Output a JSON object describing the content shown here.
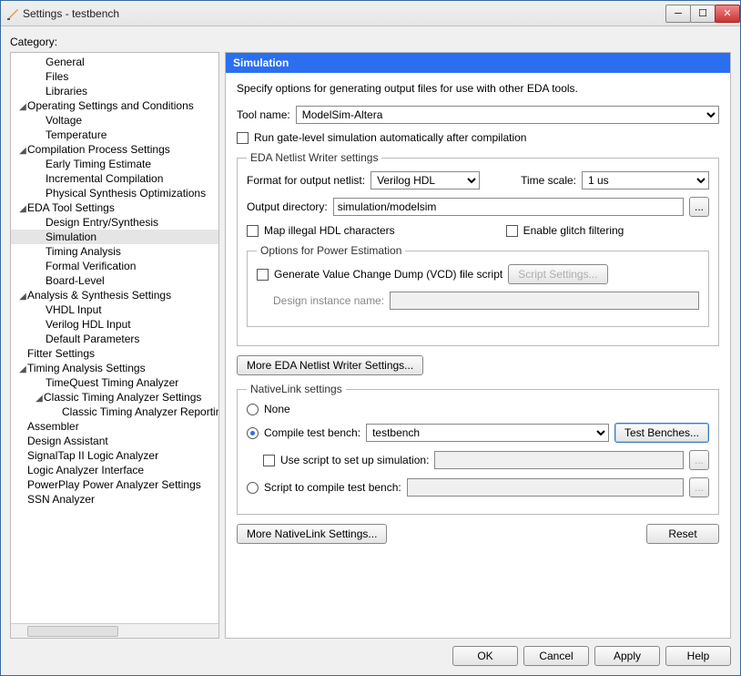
{
  "title": "Settings - testbench",
  "category_label": "Category:",
  "tree": {
    "items": [
      {
        "label": "General",
        "depth": 1
      },
      {
        "label": "Files",
        "depth": 1
      },
      {
        "label": "Libraries",
        "depth": 1
      },
      {
        "label": "Operating Settings and Conditions",
        "depth": 0,
        "expanded": true
      },
      {
        "label": "Voltage",
        "depth": 1
      },
      {
        "label": "Temperature",
        "depth": 1
      },
      {
        "label": "Compilation Process Settings",
        "depth": 0,
        "expanded": true
      },
      {
        "label": "Early Timing Estimate",
        "depth": 1
      },
      {
        "label": "Incremental Compilation",
        "depth": 1
      },
      {
        "label": "Physical Synthesis Optimizations",
        "depth": 1
      },
      {
        "label": "EDA Tool Settings",
        "depth": 0,
        "expanded": true
      },
      {
        "label": "Design Entry/Synthesis",
        "depth": 1
      },
      {
        "label": "Simulation",
        "depth": 1,
        "selected": true
      },
      {
        "label": "Timing Analysis",
        "depth": 1
      },
      {
        "label": "Formal Verification",
        "depth": 1
      },
      {
        "label": "Board-Level",
        "depth": 1
      },
      {
        "label": "Analysis & Synthesis Settings",
        "depth": 0,
        "expanded": true
      },
      {
        "label": "VHDL Input",
        "depth": 1
      },
      {
        "label": "Verilog HDL Input",
        "depth": 1
      },
      {
        "label": "Default Parameters",
        "depth": 1
      },
      {
        "label": "Fitter Settings",
        "depth": 0
      },
      {
        "label": "Timing Analysis Settings",
        "depth": 0,
        "expanded": true
      },
      {
        "label": "TimeQuest Timing Analyzer",
        "depth": 1
      },
      {
        "label": "Classic Timing Analyzer Settings",
        "depth": 1,
        "expanded": true
      },
      {
        "label": "Classic Timing Analyzer Reporting",
        "depth": 2
      },
      {
        "label": "Assembler",
        "depth": 0
      },
      {
        "label": "Design Assistant",
        "depth": 0
      },
      {
        "label": "SignalTap II Logic Analyzer",
        "depth": 0
      },
      {
        "label": "Logic Analyzer Interface",
        "depth": 0
      },
      {
        "label": "PowerPlay Power Analyzer Settings",
        "depth": 0
      },
      {
        "label": "SSN Analyzer",
        "depth": 0
      }
    ]
  },
  "main": {
    "header": "Simulation",
    "description": "Specify options for generating output files for use with other EDA tools.",
    "tool_name_label": "Tool name:",
    "tool_name_value": "ModelSim-Altera",
    "run_gate_label": "Run gate-level simulation automatically after compilation",
    "eda_fieldset": "EDA Netlist Writer settings",
    "format_label": "Format for output netlist:",
    "format_value": "Verilog HDL",
    "timescale_label": "Time scale:",
    "timescale_value": "1 us",
    "output_dir_label": "Output directory:",
    "output_dir_value": "simulation/modelsim",
    "map_illegal_label": "Map illegal HDL characters",
    "glitch_label": "Enable glitch filtering",
    "power_group": "Options for Power Estimation",
    "vcd_label": "Generate Value Change Dump (VCD) file script",
    "script_settings_btn": "Script Settings...",
    "design_instance_label": "Design instance name:",
    "more_eda_btn": "More EDA Netlist Writer Settings...",
    "nativelink_fieldset": "NativeLink settings",
    "none_label": "None",
    "compile_tb_label": "Compile test bench:",
    "compile_tb_value": "testbench",
    "test_benches_btn": "Test Benches...",
    "use_script_label": "Use script to set up simulation:",
    "script_compile_label": "Script to compile test bench:",
    "more_nativelink_btn": "More NativeLink Settings...",
    "reset_btn": "Reset",
    "browse_btn": "..."
  },
  "buttons": {
    "ok": "OK",
    "cancel": "Cancel",
    "apply": "Apply",
    "help": "Help"
  }
}
